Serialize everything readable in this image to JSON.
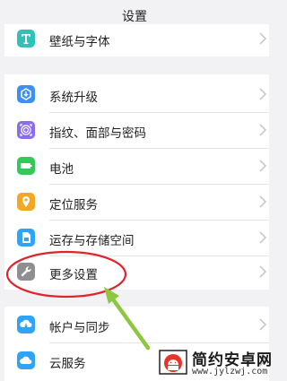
{
  "header": {
    "title": "设置"
  },
  "groups": [
    {
      "items": [
        {
          "label": "壁纸与字体",
          "icon": "font-icon",
          "color": "#2fc3b8"
        }
      ]
    },
    {
      "items": [
        {
          "label": "系统升级",
          "icon": "system-update-icon",
          "color": "#3d8ff5"
        },
        {
          "label": "指纹、面部与密码",
          "icon": "fingerprint-icon",
          "color": "#8a6cf0"
        },
        {
          "label": "电池",
          "icon": "battery-icon",
          "color": "#35c759"
        },
        {
          "label": "定位服务",
          "icon": "location-icon",
          "color": "#f5a623"
        },
        {
          "label": "运存与存储空间",
          "icon": "storage-icon",
          "color": "#2fa3f5"
        },
        {
          "label": "更多设置",
          "icon": "wrench-icon",
          "color": "#8e8e93"
        }
      ]
    },
    {
      "items": [
        {
          "label": "帐户与同步",
          "icon": "account-sync-icon",
          "color": "#2fa3f5"
        },
        {
          "label": "云服务",
          "icon": "cloud-icon",
          "color": "#2fa3f5"
        }
      ]
    }
  ],
  "annotation": {
    "circle_color": "#e0242f",
    "arrow_color": "#8dc63f"
  },
  "watermark": {
    "title": "简约安卓网",
    "url": "www.jylzwj.com",
    "logo_color": "#e8332a"
  }
}
